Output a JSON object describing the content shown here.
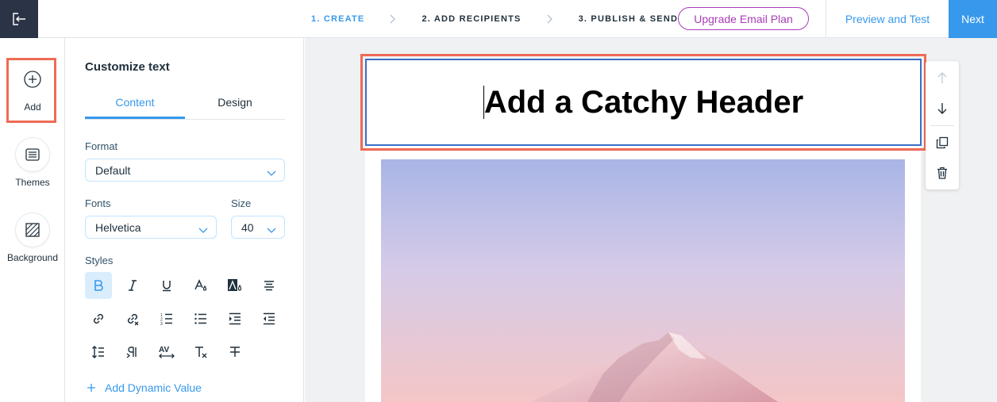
{
  "topbar": {
    "steps": [
      {
        "label": "1. CREATE",
        "active": true
      },
      {
        "label": "2. ADD RECIPIENTS",
        "active": false
      },
      {
        "label": "3. PUBLISH & SEND",
        "active": false
      }
    ],
    "upgrade_label": "Upgrade Email Plan",
    "preview_label": "Preview and Test",
    "next_label": "Next"
  },
  "rail": {
    "items": [
      {
        "label": "Add",
        "icon": "plus-circle-icon"
      },
      {
        "label": "Themes",
        "icon": "themes-icon"
      },
      {
        "label": "Background",
        "icon": "background-icon"
      }
    ]
  },
  "panel": {
    "title": "Customize text",
    "tabs": [
      "Content",
      "Design"
    ],
    "format_label": "Format",
    "format_value": "Default",
    "fonts_label": "Fonts",
    "fonts_value": "Helvetica",
    "size_label": "Size",
    "size_value": "40",
    "styles_label": "Styles",
    "dynamic_label": "Add Dynamic Value"
  },
  "canvas": {
    "header_text": "Add a Catchy Header"
  },
  "colors": {
    "accent": "#3899ec",
    "upgrade": "#a93db8",
    "highlight": "#ee6b55",
    "exit_bg": "#2b3446"
  }
}
